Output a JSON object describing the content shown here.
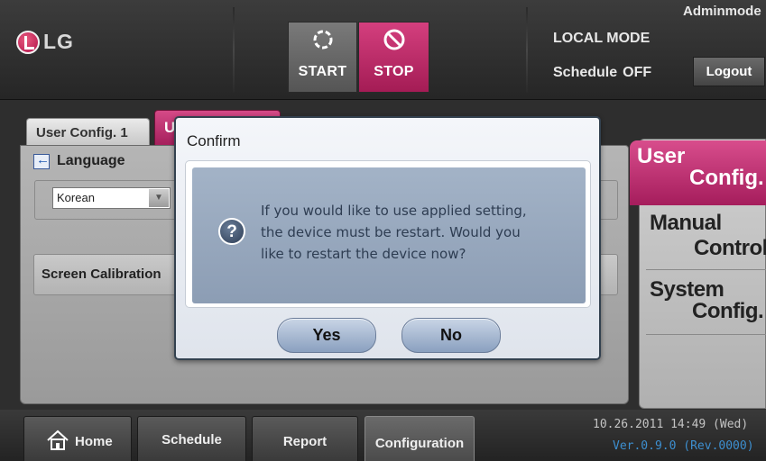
{
  "header": {
    "logo_text": "LG",
    "start_label": "START",
    "stop_label": "STOP",
    "mode_text": "LOCAL MODE",
    "schedule_label": "Schedule",
    "schedule_value": "OFF",
    "admin_text": "Adminmode",
    "logout_label": "Logout"
  },
  "tabs": [
    {
      "label": "User Config. 1"
    },
    {
      "label": "U"
    }
  ],
  "main": {
    "language_label": "Language",
    "language_value": "Korean",
    "screen_calibration_label": "Screen Calibration"
  },
  "right_nav": {
    "user_config_line1": "User",
    "user_config_line2": "Config.",
    "manual_line1": "Manual",
    "manual_line2": "Control",
    "system_line1": "System",
    "system_line2": "Config."
  },
  "footer": {
    "home_label": "Home",
    "schedule_label": "Schedule",
    "report_label": "Report",
    "configuration_label": "Configuration",
    "datetime": "10.26.2011  14:49  (Wed)",
    "version": "Ver.0.9.0 (Rev.0000)"
  },
  "dialog": {
    "title": "Confirm",
    "message_line1": "If you would like to use applied setting,",
    "message_line2": "the device must be restart.  Would you",
    "message_line3": "like to restart the device now?",
    "yes_label": "Yes",
    "no_label": "No",
    "icon": "question-icon"
  },
  "colors": {
    "accent_pink": "#c0306e",
    "dialog_msg_bg": "#9aabc1",
    "version_blue": "#3d8fd0"
  }
}
